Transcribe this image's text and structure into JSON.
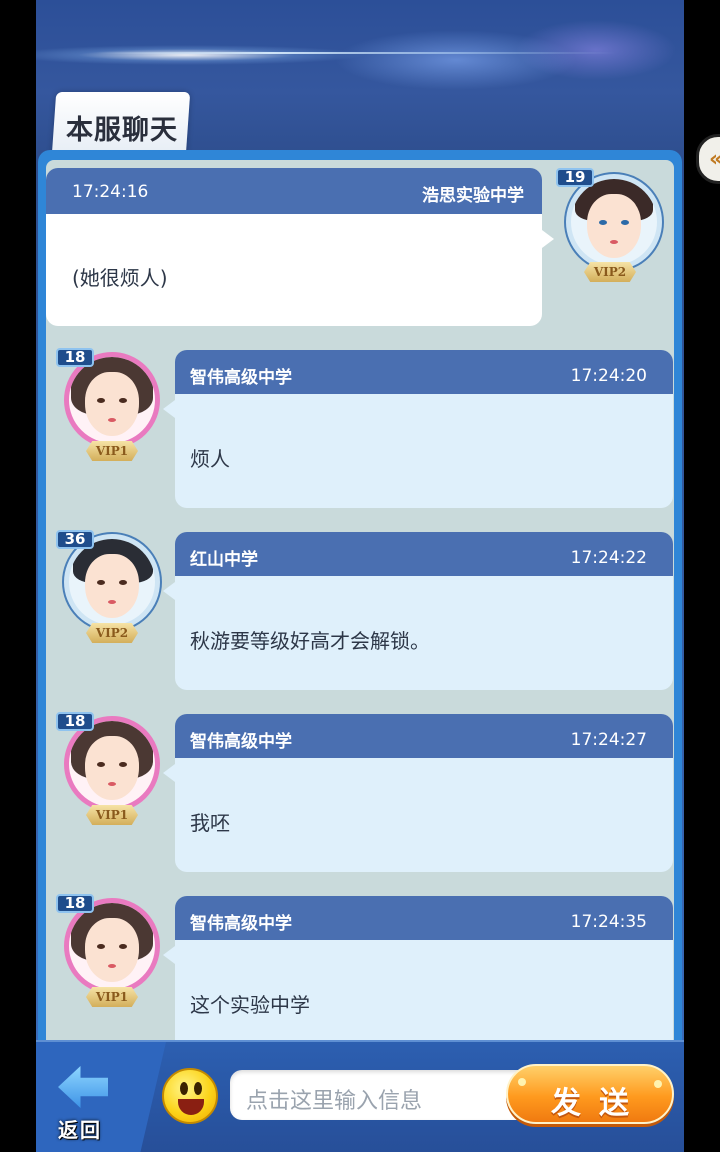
{
  "title": "本服聊天",
  "my_message": {
    "time": "17:24:16",
    "school": "浩思实验中学",
    "text": "(她很烦人)",
    "level": "19",
    "vip": "VIP2"
  },
  "messages": [
    {
      "school": "智伟高级中学",
      "time": "17:24:20",
      "text": "烦人",
      "level": "18",
      "vip": "VIP1",
      "avatar": "girl-avatar"
    },
    {
      "school": "红山中学",
      "time": "17:24:22",
      "text": "秋游要等级好高才会解锁。",
      "level": "36",
      "vip": "VIP2",
      "avatar": "boy-avatar"
    },
    {
      "school": "智伟高级中学",
      "time": "17:24:27",
      "text": "我呸",
      "level": "18",
      "vip": "VIP1",
      "avatar": "girl-avatar"
    },
    {
      "school": "智伟高级中学",
      "time": "17:24:35",
      "text": "这个实验中学",
      "level": "18",
      "vip": "VIP1",
      "avatar": "girl-avatar"
    }
  ],
  "bottom_bar": {
    "back_label": "返回",
    "input_placeholder": "点击这里输入信息",
    "send_label": "发送"
  },
  "side_tab": {
    "label": "«"
  },
  "colors": {
    "header_blue": "#4a6fb1",
    "bubble_light": "#dff0fb",
    "panel_blue": "#2f86d7",
    "send_orange": "#ff9a1e"
  }
}
